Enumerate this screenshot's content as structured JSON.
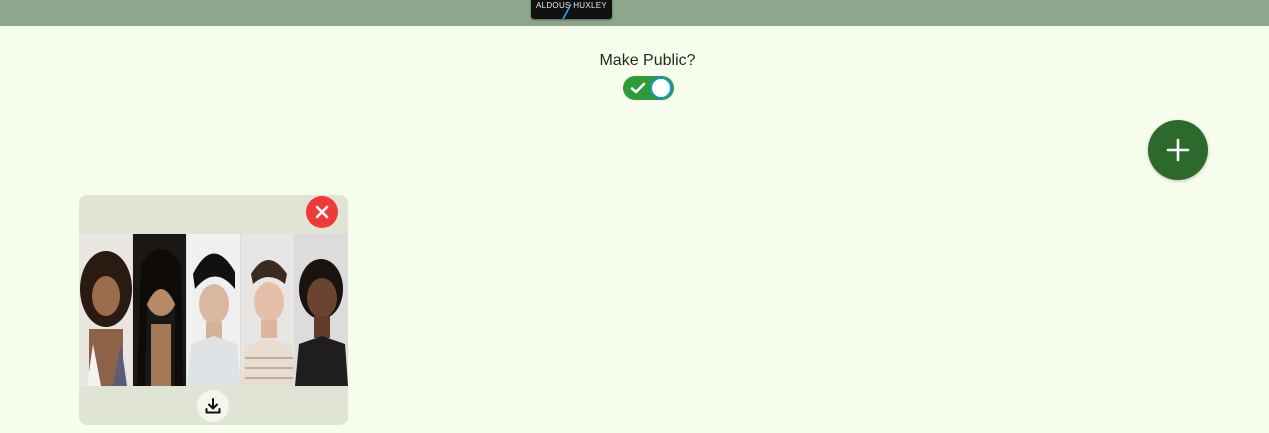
{
  "header": {
    "book_thumbnail_text": "ALDOUS HUXLEY"
  },
  "visibility": {
    "label": "Make Public?",
    "toggle_state": "on"
  },
  "add_button": {
    "icon": "plus-icon"
  },
  "image_card": {
    "delete_icon": "close-icon",
    "download_icon": "download-icon",
    "portraits": [
      {
        "name": "portrait-1"
      },
      {
        "name": "portrait-2"
      },
      {
        "name": "portrait-3"
      },
      {
        "name": "portrait-4"
      },
      {
        "name": "portrait-5"
      }
    ]
  },
  "colors": {
    "background": "#f7fdec",
    "topbar": "#8da68c",
    "toggle_on": "#2e9b3a",
    "fab": "#2c6a2c",
    "delete": "#ef3a3a",
    "card": "#e0e4d5"
  }
}
